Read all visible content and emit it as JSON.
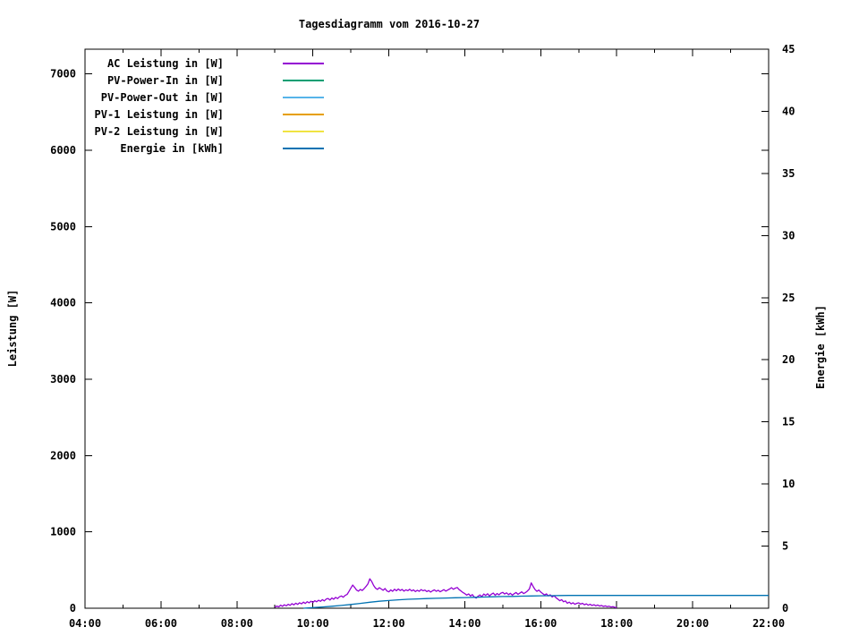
{
  "title": "Tagesdiagramm vom 2016-10-27",
  "axes": {
    "y1_label": "Leistung [W]",
    "y2_label": "Energie [kWh]"
  },
  "chart_data": {
    "type": "line",
    "title": "Tagesdiagramm vom 2016-10-27",
    "xlabel": "",
    "ylabel": "Leistung [W]",
    "y2label": "Energie [kWh]",
    "x_range_hours": [
      4,
      22
    ],
    "y1_range": [
      0,
      7325
    ],
    "y2_range": [
      0,
      45
    ],
    "grid": false,
    "legend_position": "top-left",
    "x_ticks": [
      {
        "t": 4,
        "label": "04:00"
      },
      {
        "t": 6,
        "label": "06:00"
      },
      {
        "t": 8,
        "label": "08:00"
      },
      {
        "t": 10,
        "label": "10:00"
      },
      {
        "t": 12,
        "label": "12:00"
      },
      {
        "t": 14,
        "label": "14:00"
      },
      {
        "t": 16,
        "label": "16:00"
      },
      {
        "t": 18,
        "label": "18:00"
      },
      {
        "t": 20,
        "label": "20:00"
      },
      {
        "t": 22,
        "label": "22:00"
      }
    ],
    "x_minor_ticks": [
      5,
      7,
      9,
      11,
      13,
      15,
      17,
      19,
      21
    ],
    "y1_ticks": [
      {
        "v": 0,
        "label": "0"
      },
      {
        "v": 1000,
        "label": "1000"
      },
      {
        "v": 2000,
        "label": "2000"
      },
      {
        "v": 3000,
        "label": "3000"
      },
      {
        "v": 4000,
        "label": "4000"
      },
      {
        "v": 5000,
        "label": "5000"
      },
      {
        "v": 6000,
        "label": "6000"
      },
      {
        "v": 7000,
        "label": "7000"
      }
    ],
    "y2_ticks": [
      {
        "v": 0,
        "label": "0"
      },
      {
        "v": 5,
        "label": "5"
      },
      {
        "v": 10,
        "label": "10"
      },
      {
        "v": 15,
        "label": "15"
      },
      {
        "v": 20,
        "label": "20"
      },
      {
        "v": 25,
        "label": "25"
      },
      {
        "v": 30,
        "label": "30"
      },
      {
        "v": 35,
        "label": "35"
      },
      {
        "v": 40,
        "label": "40"
      },
      {
        "v": 45,
        "label": "45"
      }
    ],
    "series": [
      {
        "name": "AC Leistung in [W]",
        "color": "#9400d3",
        "axis": "y1",
        "points": [
          [
            9.0,
            12
          ],
          [
            9.05,
            28
          ],
          [
            9.1,
            18
          ],
          [
            9.15,
            40
          ],
          [
            9.2,
            26
          ],
          [
            9.25,
            44
          ],
          [
            9.3,
            32
          ],
          [
            9.35,
            52
          ],
          [
            9.4,
            38
          ],
          [
            9.45,
            60
          ],
          [
            9.5,
            44
          ],
          [
            9.55,
            66
          ],
          [
            9.6,
            50
          ],
          [
            9.65,
            72
          ],
          [
            9.7,
            58
          ],
          [
            9.75,
            80
          ],
          [
            9.8,
            62
          ],
          [
            9.85,
            86
          ],
          [
            9.9,
            70
          ],
          [
            9.95,
            92
          ],
          [
            10.0,
            76
          ],
          [
            10.05,
            98
          ],
          [
            10.1,
            84
          ],
          [
            10.15,
            104
          ],
          [
            10.2,
            90
          ],
          [
            10.25,
            112
          ],
          [
            10.3,
            96
          ],
          [
            10.35,
            120
          ],
          [
            10.4,
            128
          ],
          [
            10.45,
            108
          ],
          [
            10.5,
            134
          ],
          [
            10.55,
            118
          ],
          [
            10.6,
            142
          ],
          [
            10.65,
            126
          ],
          [
            10.7,
            150
          ],
          [
            10.75,
            160
          ],
          [
            10.8,
            144
          ],
          [
            10.85,
            168
          ],
          [
            10.9,
            180
          ],
          [
            10.95,
            220
          ],
          [
            11.0,
            262
          ],
          [
            11.05,
            304
          ],
          [
            11.1,
            272
          ],
          [
            11.15,
            238
          ],
          [
            11.2,
            224
          ],
          [
            11.25,
            246
          ],
          [
            11.3,
            232
          ],
          [
            11.35,
            258
          ],
          [
            11.4,
            286
          ],
          [
            11.45,
            320
          ],
          [
            11.5,
            386
          ],
          [
            11.55,
            348
          ],
          [
            11.6,
            298
          ],
          [
            11.65,
            262
          ],
          [
            11.7,
            246
          ],
          [
            11.75,
            268
          ],
          [
            11.8,
            252
          ],
          [
            11.85,
            236
          ],
          [
            11.9,
            258
          ],
          [
            11.95,
            226
          ],
          [
            12.0,
            214
          ],
          [
            12.05,
            240
          ],
          [
            12.1,
            222
          ],
          [
            12.15,
            248
          ],
          [
            12.2,
            228
          ],
          [
            12.25,
            252
          ],
          [
            12.3,
            232
          ],
          [
            12.35,
            246
          ],
          [
            12.4,
            224
          ],
          [
            12.45,
            242
          ],
          [
            12.5,
            230
          ],
          [
            12.55,
            248
          ],
          [
            12.6,
            226
          ],
          [
            12.65,
            240
          ],
          [
            12.7,
            218
          ],
          [
            12.75,
            236
          ],
          [
            12.8,
            222
          ],
          [
            12.85,
            244
          ],
          [
            12.9,
            228
          ],
          [
            12.95,
            238
          ],
          [
            13.0,
            218
          ],
          [
            13.05,
            232
          ],
          [
            13.1,
            212
          ],
          [
            13.15,
            228
          ],
          [
            13.2,
            240
          ],
          [
            13.25,
            222
          ],
          [
            13.3,
            236
          ],
          [
            13.35,
            216
          ],
          [
            13.4,
            230
          ],
          [
            13.45,
            244
          ],
          [
            13.5,
            224
          ],
          [
            13.55,
            238
          ],
          [
            13.6,
            252
          ],
          [
            13.65,
            268
          ],
          [
            13.7,
            248
          ],
          [
            13.75,
            262
          ],
          [
            13.8,
            272
          ],
          [
            13.85,
            244
          ],
          [
            13.9,
            226
          ],
          [
            13.95,
            206
          ],
          [
            14.0,
            192
          ],
          [
            14.05,
            172
          ],
          [
            14.1,
            188
          ],
          [
            14.15,
            160
          ],
          [
            14.2,
            178
          ],
          [
            14.25,
            146
          ],
          [
            14.3,
            132
          ],
          [
            14.35,
            158
          ],
          [
            14.4,
            174
          ],
          [
            14.45,
            152
          ],
          [
            14.5,
            186
          ],
          [
            14.55,
            168
          ],
          [
            14.6,
            190
          ],
          [
            14.65,
            162
          ],
          [
            14.7,
            184
          ],
          [
            14.75,
            198
          ],
          [
            14.8,
            170
          ],
          [
            14.85,
            192
          ],
          [
            14.9,
            176
          ],
          [
            14.95,
            198
          ],
          [
            15.0,
            208
          ],
          [
            15.05,
            186
          ],
          [
            15.1,
            202
          ],
          [
            15.15,
            178
          ],
          [
            15.2,
            196
          ],
          [
            15.25,
            172
          ],
          [
            15.3,
            190
          ],
          [
            15.35,
            206
          ],
          [
            15.4,
            182
          ],
          [
            15.45,
            198
          ],
          [
            15.5,
            214
          ],
          [
            15.55,
            192
          ],
          [
            15.6,
            206
          ],
          [
            15.65,
            226
          ],
          [
            15.7,
            252
          ],
          [
            15.75,
            332
          ],
          [
            15.8,
            286
          ],
          [
            15.85,
            244
          ],
          [
            15.9,
            222
          ],
          [
            15.95,
            238
          ],
          [
            16.0,
            212
          ],
          [
            16.05,
            192
          ],
          [
            16.1,
            174
          ],
          [
            16.15,
            188
          ],
          [
            16.2,
            162
          ],
          [
            16.25,
            176
          ],
          [
            16.3,
            148
          ],
          [
            16.35,
            164
          ],
          [
            16.4,
            138
          ],
          [
            16.45,
            120
          ],
          [
            16.5,
            98
          ],
          [
            16.55,
            112
          ],
          [
            16.6,
            84
          ],
          [
            16.65,
            96
          ],
          [
            16.7,
            66
          ],
          [
            16.75,
            80
          ],
          [
            16.8,
            58
          ],
          [
            16.85,
            72
          ],
          [
            16.9,
            52
          ],
          [
            16.95,
            64
          ],
          [
            17.0,
            70
          ],
          [
            17.05,
            54
          ],
          [
            17.1,
            64
          ],
          [
            17.15,
            46
          ],
          [
            17.2,
            58
          ],
          [
            17.25,
            40
          ],
          [
            17.3,
            52
          ],
          [
            17.35,
            36
          ],
          [
            17.4,
            46
          ],
          [
            17.45,
            32
          ],
          [
            17.5,
            42
          ],
          [
            17.55,
            28
          ],
          [
            17.6,
            36
          ],
          [
            17.65,
            24
          ],
          [
            17.7,
            30
          ],
          [
            17.75,
            20
          ],
          [
            17.8,
            26
          ],
          [
            17.85,
            16
          ],
          [
            17.9,
            20
          ],
          [
            17.95,
            12
          ],
          [
            18.0,
            8
          ]
        ]
      },
      {
        "name": "PV-Power-In in [W]",
        "color": "#009e73",
        "axis": "y1",
        "points": []
      },
      {
        "name": "PV-Power-Out in [W]",
        "color": "#56b4e9",
        "axis": "y1",
        "points": []
      },
      {
        "name": "PV-1 Leistung in [W]",
        "color": "#e69f00",
        "axis": "y1",
        "points": []
      },
      {
        "name": "PV-2 Leistung in [W]",
        "color": "#f0e442",
        "axis": "y1",
        "points": []
      },
      {
        "name": "Energie in [kWh]",
        "color": "#0072b2",
        "axis": "y2",
        "points": [
          [
            9.75,
            0.0
          ],
          [
            10.0,
            0.05
          ],
          [
            10.25,
            0.1
          ],
          [
            10.5,
            0.16
          ],
          [
            10.75,
            0.22
          ],
          [
            11.0,
            0.3
          ],
          [
            11.25,
            0.39
          ],
          [
            11.5,
            0.48
          ],
          [
            11.75,
            0.56
          ],
          [
            12.0,
            0.62
          ],
          [
            12.25,
            0.68
          ],
          [
            12.5,
            0.72
          ],
          [
            12.75,
            0.75
          ],
          [
            13.0,
            0.78
          ],
          [
            13.25,
            0.8
          ],
          [
            13.5,
            0.82
          ],
          [
            13.75,
            0.84
          ],
          [
            14.0,
            0.86
          ],
          [
            14.25,
            0.88
          ],
          [
            14.5,
            0.9
          ],
          [
            14.75,
            0.92
          ],
          [
            15.0,
            0.94
          ],
          [
            15.25,
            0.95
          ],
          [
            15.5,
            0.97
          ],
          [
            15.75,
            0.99
          ],
          [
            16.0,
            1.0
          ],
          [
            16.25,
            1.01
          ],
          [
            16.5,
            1.02
          ],
          [
            16.75,
            1.03
          ],
          [
            17.0,
            1.03
          ],
          [
            18.0,
            1.03
          ],
          [
            19.0,
            1.03
          ],
          [
            20.0,
            1.03
          ],
          [
            21.0,
            1.03
          ],
          [
            22.0,
            1.03
          ]
        ]
      }
    ]
  }
}
